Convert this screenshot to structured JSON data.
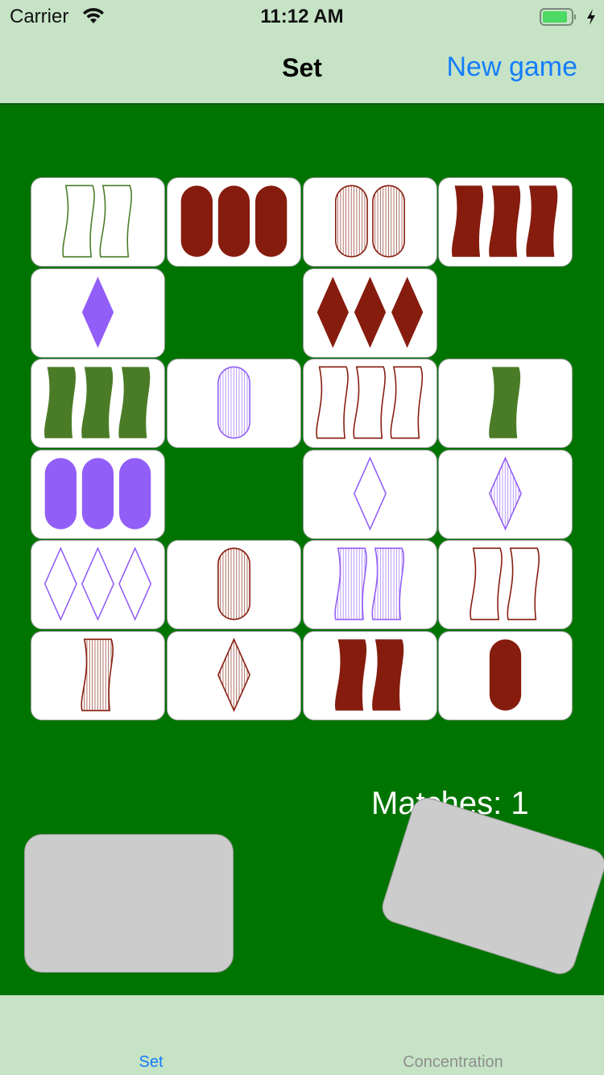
{
  "status_bar": {
    "carrier": "Carrier",
    "time": "11:12 AM",
    "wifi_icon": "wifi-icon",
    "battery_icon": "battery-charging-icon",
    "battery_color": "#4cd964"
  },
  "nav": {
    "title": "Set",
    "new_game_label": "New game",
    "accent_color": "#147efb"
  },
  "board": {
    "background_color": "#007400",
    "matches_label": "Matches: 1",
    "colors": {
      "red": "#861c0e",
      "green": "#4a7c27",
      "purple": "#925ef8"
    },
    "rows": [
      [
        {
          "count": 2,
          "shape": "squiggle",
          "shading": "open",
          "color": "green"
        },
        {
          "count": 3,
          "shape": "oval",
          "shading": "solid",
          "color": "red"
        },
        {
          "count": 2,
          "shape": "oval",
          "shading": "striped",
          "color": "red"
        },
        {
          "count": 3,
          "shape": "squiggle",
          "shading": "solid",
          "color": "red"
        }
      ],
      [
        {
          "count": 1,
          "shape": "diamond",
          "shading": "solid",
          "color": "purple"
        },
        null,
        {
          "count": 3,
          "shape": "diamond",
          "shading": "solid",
          "color": "red"
        },
        null
      ],
      [
        {
          "count": 3,
          "shape": "squiggle",
          "shading": "solid",
          "color": "green"
        },
        {
          "count": 1,
          "shape": "oval",
          "shading": "striped",
          "color": "purple"
        },
        {
          "count": 3,
          "shape": "squiggle",
          "shading": "open",
          "color": "red"
        },
        {
          "count": 1,
          "shape": "squiggle",
          "shading": "solid",
          "color": "green"
        }
      ],
      [
        {
          "count": 3,
          "shape": "oval",
          "shading": "solid",
          "color": "purple"
        },
        null,
        {
          "count": 1,
          "shape": "diamond",
          "shading": "open",
          "color": "purple"
        },
        {
          "count": 1,
          "shape": "diamond",
          "shading": "striped",
          "color": "purple"
        }
      ],
      [
        {
          "count": 3,
          "shape": "diamond",
          "shading": "open",
          "color": "purple"
        },
        {
          "count": 1,
          "shape": "oval",
          "shading": "striped",
          "color": "red"
        },
        {
          "count": 2,
          "shape": "squiggle",
          "shading": "striped",
          "color": "purple"
        },
        {
          "count": 2,
          "shape": "squiggle",
          "shading": "open",
          "color": "red"
        }
      ],
      [
        {
          "count": 1,
          "shape": "squiggle",
          "shading": "striped",
          "color": "red"
        },
        {
          "count": 1,
          "shape": "diamond",
          "shading": "striped",
          "color": "red"
        },
        {
          "count": 2,
          "shape": "squiggle",
          "shading": "solid",
          "color": "red"
        },
        {
          "count": 1,
          "shape": "oval",
          "shading": "solid",
          "color": "red"
        }
      ]
    ],
    "deck_color": "#cccccc"
  },
  "tabbar": {
    "tabs": [
      {
        "label": "Set",
        "active": true
      },
      {
        "label": "Concentration",
        "active": false
      }
    ]
  }
}
